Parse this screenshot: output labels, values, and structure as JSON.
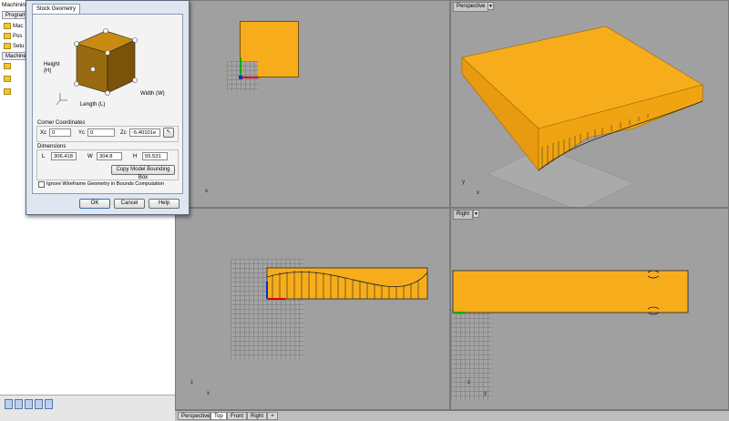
{
  "left_panel": {
    "title": "Machining",
    "tabs": [
      "Program"
    ],
    "tree": [
      "Mac",
      "Pos",
      "Setu"
    ],
    "machine_tab": "Machine"
  },
  "dialog": {
    "tab": "Stock Geometry",
    "preview_labels": {
      "height": "Height\n(H)",
      "length": "Length (L)",
      "width": "Width (W)"
    },
    "corner_title": "Corner Coordinates",
    "xc_label": "Xc",
    "xc_value": "0",
    "yc_label": "Yc",
    "yc_value": "0",
    "zc_label": "Zc",
    "zc_value": "-5.40101e",
    "dims_title": "Dimensions",
    "l_label": "L",
    "l_value": "306.418",
    "w_label": "W",
    "w_value": "304.8",
    "h_label": "H",
    "h_value": "55.531",
    "copy_button": "Copy Model Bounding Box",
    "ignore_checkbox": "Ignore Wireframe Geometry in Bounds Computation",
    "ok": "OK",
    "cancel": "Cancel",
    "help": "Help"
  },
  "viewports": {
    "top_right_label": "Perspective",
    "bottom_right_label": "Right",
    "axis_y": "y",
    "axis_x": "x",
    "axis_z": "z"
  },
  "viewport_tabs": [
    "Perspective",
    "Top",
    "Front",
    "Right"
  ],
  "viewport_tabs_add": "+",
  "colors": {
    "stock": "#f7ad1b",
    "stock_dark": "#c97a00"
  }
}
